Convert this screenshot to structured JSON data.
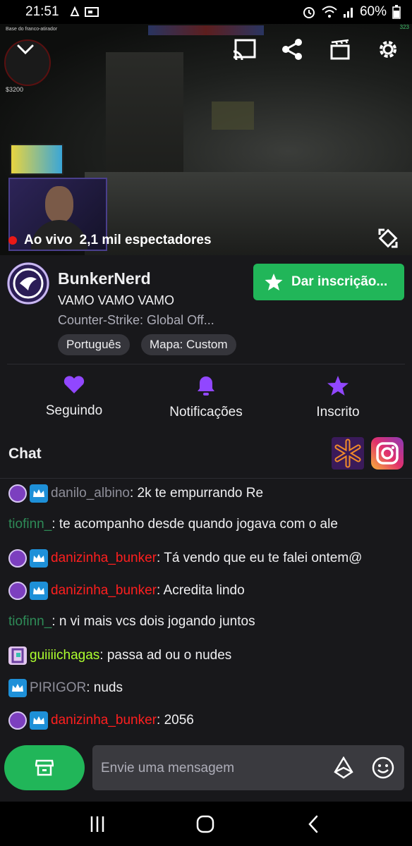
{
  "status_bar": {
    "time": "21:51",
    "battery": "60%"
  },
  "video": {
    "hud_label": "Base do franco-atirador",
    "money": "$3200",
    "hud_counter": "323",
    "live_label": "Ao vivo",
    "viewers": "2,1 mil espectadores"
  },
  "channel": {
    "name": "BunkerNerd",
    "title": "VAMO VAMO VAMO",
    "game": "Counter-Strike: Global Off...",
    "subscribe_label": "Dar inscrição...",
    "tags": [
      "Português",
      "Mapa: Custom"
    ]
  },
  "actions": {
    "following": "Seguindo",
    "notifications": "Notificações",
    "subscribed": "Inscrito"
  },
  "chat": {
    "title": "Chat",
    "messages": [
      {
        "badges": [
          "purple",
          "sub"
        ],
        "user": "danilo_albino",
        "color": "#8e8e99",
        "text": ": 2k te empurrando Re"
      },
      {
        "badges": [],
        "user": "tiofinn_",
        "color": "#2e8b57",
        "text": ": te acompanho desde quando jogava com o ale"
      },
      {
        "badges": [
          "purple",
          "sub"
        ],
        "user": "danizinha_bunker",
        "color": "#ff1f1f",
        "text": ": Tá vendo que eu te falei ontem@"
      },
      {
        "badges": [
          "purple",
          "sub"
        ],
        "user": "danizinha_bunker",
        "color": "#ff1f1f",
        "text": ": Acredita lindo"
      },
      {
        "badges": [],
        "user": "tiofinn_",
        "color": "#2e8b57",
        "text": ": n vi mais vcs dois jogando juntos"
      },
      {
        "badges": [
          "pink"
        ],
        "user": "guiiiichagas",
        "color": "#adff2f",
        "text": ": passa ad ou o nudes"
      },
      {
        "badges": [
          "sub"
        ],
        "user": "PIRIGOR",
        "color": "#8e8e99",
        "text": ": nuds"
      },
      {
        "badges": [
          "purple",
          "sub"
        ],
        "user": "danizinha_bunker",
        "color": "#ff1f1f",
        "text": ": 2056"
      }
    ],
    "input_placeholder": "Envie uma mensagem"
  },
  "colors": {
    "accent_green": "#21b659",
    "accent_purple": "#9147ff",
    "live_red": "#e91916"
  }
}
